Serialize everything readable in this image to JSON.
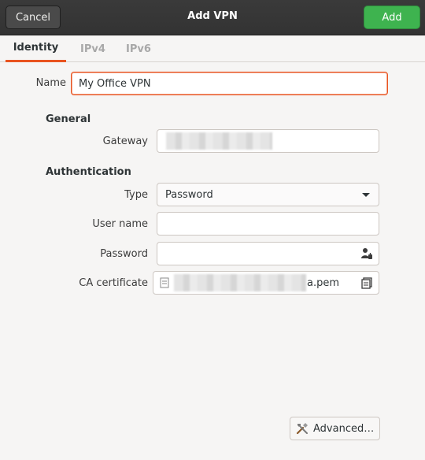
{
  "header": {
    "cancel_label": "Cancel",
    "title": "Add VPN",
    "add_label": "Add"
  },
  "tabs": [
    {
      "label": "Identity",
      "active": true
    },
    {
      "label": "IPv4",
      "active": false
    },
    {
      "label": "IPv6",
      "active": false
    }
  ],
  "identity": {
    "name_label": "Name",
    "name_value": "My Office VPN",
    "general_heading": "General",
    "gateway_label": "Gateway",
    "authentication_heading": "Authentication",
    "type_label": "Type",
    "type_value": "Password",
    "username_label": "User name",
    "username_value": "",
    "password_label": "Password",
    "password_value": "",
    "ca_label": "CA certificate",
    "ca_value_suffix": "a.pem",
    "advanced_label": "Advanced…"
  },
  "icons": {
    "password_icon": "user-password-icon",
    "ca_file_icon": "file-icon",
    "ca_browse_icon": "browse-file-icon",
    "advanced_icon": "tools-icon"
  },
  "colors": {
    "accent": "#e95420",
    "add_button": "#3eb34f",
    "headerbar": "#333333",
    "background": "#f6f5f4"
  }
}
